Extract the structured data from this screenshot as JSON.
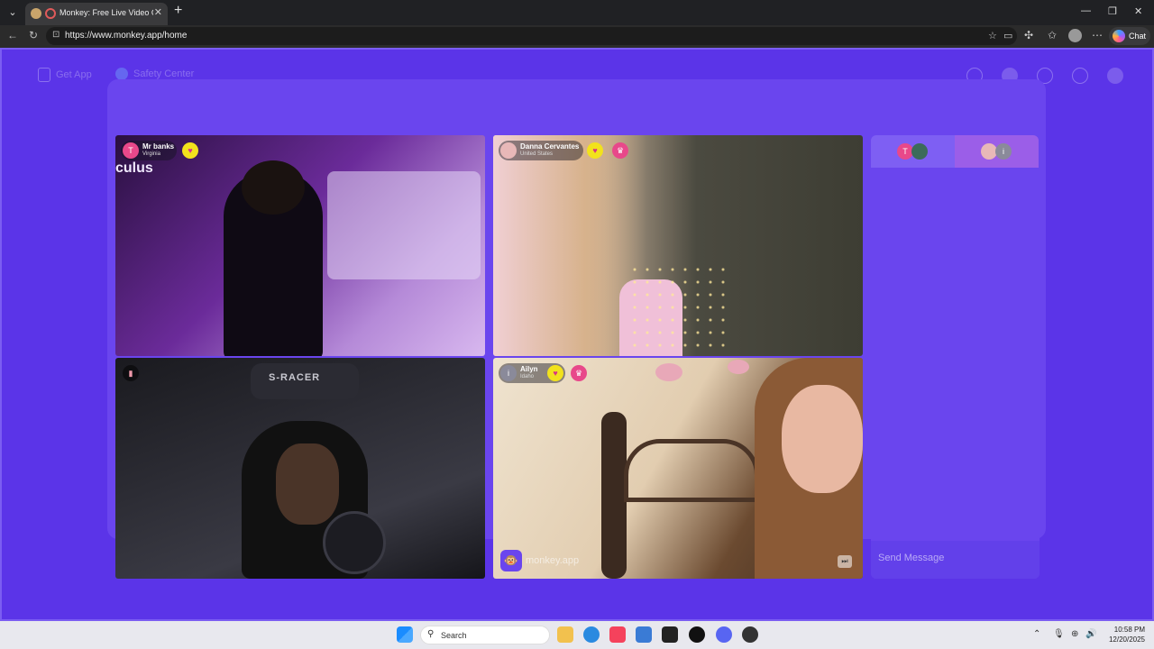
{
  "browser": {
    "tab_title": "Monkey: Free Live Video Chat",
    "url": "https://www.monkey.app/home",
    "chat_button": "Chat"
  },
  "header": {
    "get_app": "Get App",
    "safety_center": "Safety Center"
  },
  "videos": [
    {
      "avatar_letter": "T",
      "name": "Mr banks",
      "location": "Virginia"
    },
    {
      "name": "Danna Cervantes",
      "location": "United States"
    },
    {},
    {
      "avatar_letter": "i",
      "name": "Ailyn",
      "location": "Idaho",
      "watermark": "monkey.app"
    }
  ],
  "video1_overlay_text": "culus",
  "video3_overlay_text": "S-RACER",
  "chat": {
    "tab_a_letter": "T",
    "tab_b_letter": "i",
    "send_placeholder": "Send Message"
  },
  "taskbar": {
    "search_text": "Search",
    "time": "10:58 PM",
    "date": "12/20/2025"
  },
  "colors": {
    "page_bg": "#5b34e8",
    "heart_badge": "#f2e21c",
    "pink_badge": "#e8488a"
  }
}
